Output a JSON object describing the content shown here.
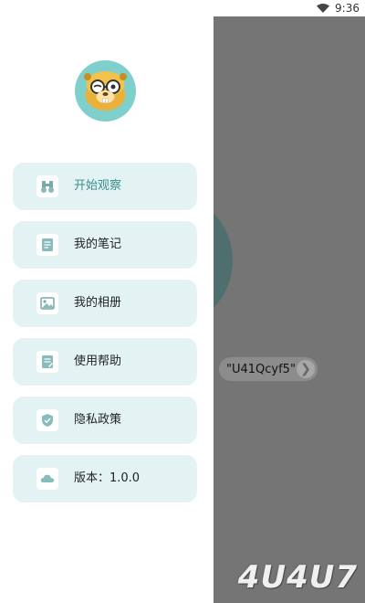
{
  "status_bar": {
    "time": "9:36"
  },
  "drawer": {
    "menu": [
      {
        "id": "start",
        "label": "开始观察",
        "icon": "binoculars-icon"
      },
      {
        "id": "notes",
        "label": "我的笔记",
        "icon": "note-icon"
      },
      {
        "id": "album",
        "label": "我的相册",
        "icon": "image-icon"
      },
      {
        "id": "help",
        "label": "使用帮助",
        "icon": "help-doc-icon"
      },
      {
        "id": "privacy",
        "label": "隐私政策",
        "icon": "shield-icon"
      },
      {
        "id": "version",
        "label": "版本：1.0.0",
        "icon": "cloud-icon"
      }
    ]
  },
  "background": {
    "chip_text": "\"U41Qcyf5\""
  },
  "watermark": "4U4U7",
  "colors": {
    "accent": "#3a8f8c",
    "menu_bg": "#e3f3f4",
    "avatar_bg": "#7fd0cc",
    "overlay": "#757575"
  }
}
